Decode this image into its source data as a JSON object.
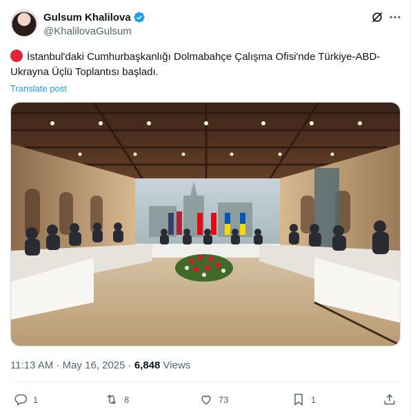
{
  "author": {
    "display_name": "Gulsum Khalilova",
    "handle": "@KhalilovaGulsum",
    "verified": true,
    "verified_color": "#1d9bf0"
  },
  "tweet": {
    "text": "İstanbul'daki Cumhurbaşkanlığı Dolmabahçe Çalışma Ofisi'nde Türkiye-ABD-Ukrayna Üçlü Toplantısı başladı.",
    "lead_icon": "red-circle-emoji",
    "lead_icon_color": "#e0243a",
    "translate_label": "Translate post",
    "timestamp": "11:13 AM · May 16, 2025 · ",
    "views_count": "6,848",
    "views_label": " Views"
  },
  "actions": {
    "reply_count": "1",
    "retweet_count": "8",
    "like_count": "73",
    "bookmark_count": "1"
  },
  "colors": {
    "accent": "#1d9bf0",
    "secondary_text": "#536471",
    "primary_text": "#0f1419"
  }
}
